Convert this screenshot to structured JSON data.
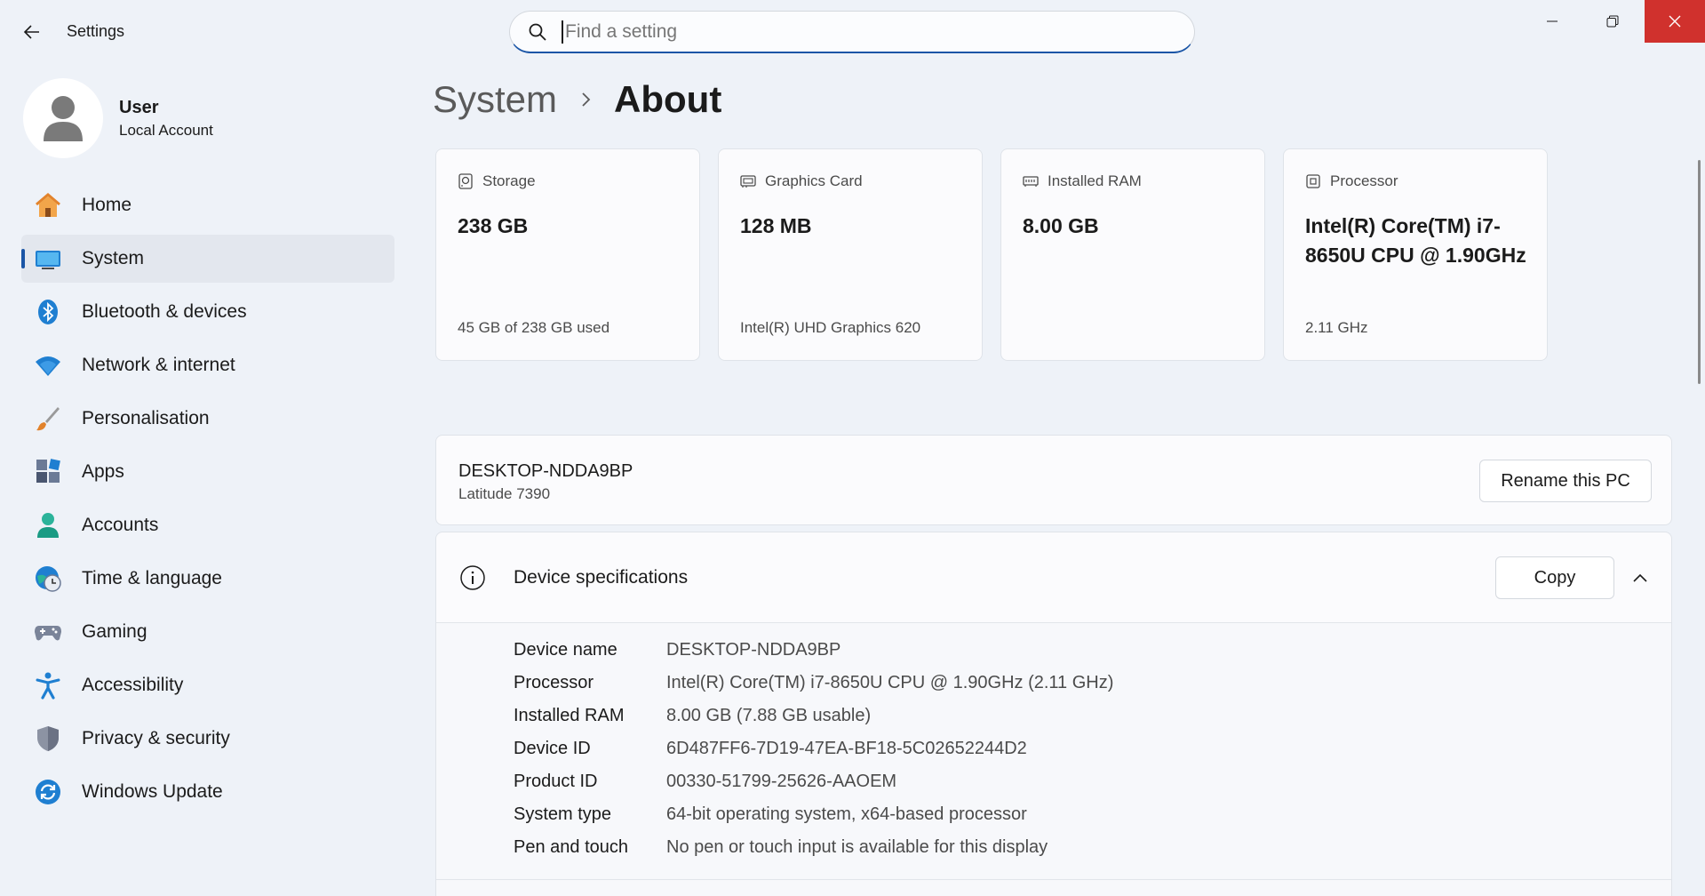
{
  "window": {
    "app_title": "Settings",
    "search_placeholder": "Find a setting"
  },
  "user": {
    "name": "User",
    "account_type": "Local Account"
  },
  "nav": [
    {
      "label": "Home",
      "icon": "home-icon"
    },
    {
      "label": "System",
      "icon": "system-icon",
      "active": true
    },
    {
      "label": "Bluetooth & devices",
      "icon": "bluetooth-icon"
    },
    {
      "label": "Network & internet",
      "icon": "wifi-icon"
    },
    {
      "label": "Personalisation",
      "icon": "paintbrush-icon"
    },
    {
      "label": "Apps",
      "icon": "apps-icon"
    },
    {
      "label": "Accounts",
      "icon": "accounts-icon"
    },
    {
      "label": "Time & language",
      "icon": "time-language-icon"
    },
    {
      "label": "Gaming",
      "icon": "gamepad-icon"
    },
    {
      "label": "Accessibility",
      "icon": "accessibility-icon"
    },
    {
      "label": "Privacy & security",
      "icon": "shield-icon"
    },
    {
      "label": "Windows Update",
      "icon": "update-icon"
    }
  ],
  "breadcrumb": {
    "parent": "System",
    "current": "About"
  },
  "cards": [
    {
      "label": "Storage",
      "icon": "storage-icon",
      "value": "238 GB",
      "sub": "45 GB of 238 GB used"
    },
    {
      "label": "Graphics Card",
      "icon": "graphics-card-icon",
      "value": "128 MB",
      "sub": "Intel(R) UHD Graphics 620"
    },
    {
      "label": "Installed RAM",
      "icon": "ram-icon",
      "value": "8.00 GB",
      "sub": ""
    },
    {
      "label": "Processor",
      "icon": "processor-icon",
      "value": "Intel(R) Core(TM) i7-8650U CPU @ 1.90GHz",
      "sub": "2.11 GHz"
    }
  ],
  "pc": {
    "name": "DESKTOP-NDDA9BP",
    "model": "Latitude 7390",
    "rename_label": "Rename this PC"
  },
  "specs": {
    "title": "Device specifications",
    "copy_label": "Copy",
    "rows": [
      {
        "key": "Device name",
        "value": "DESKTOP-NDDA9BP"
      },
      {
        "key": "Processor",
        "value": "Intel(R) Core(TM) i7-8650U CPU @ 1.90GHz (2.11 GHz)"
      },
      {
        "key": "Installed RAM",
        "value": "8.00 GB (7.88 GB usable)"
      },
      {
        "key": "Device ID",
        "value": "6D487FF6-7D19-47EA-BF18-5C02652244D2"
      },
      {
        "key": "Product ID",
        "value": "00330-51799-25626-AAOEM"
      },
      {
        "key": "System type",
        "value": "64-bit operating system, x64-based processor"
      },
      {
        "key": "Pen and touch",
        "value": "No pen or touch input is available for this display"
      }
    ]
  },
  "colors": {
    "accent": "#1a55a6",
    "background": "#eef2f8",
    "close_button": "#d0312d"
  }
}
